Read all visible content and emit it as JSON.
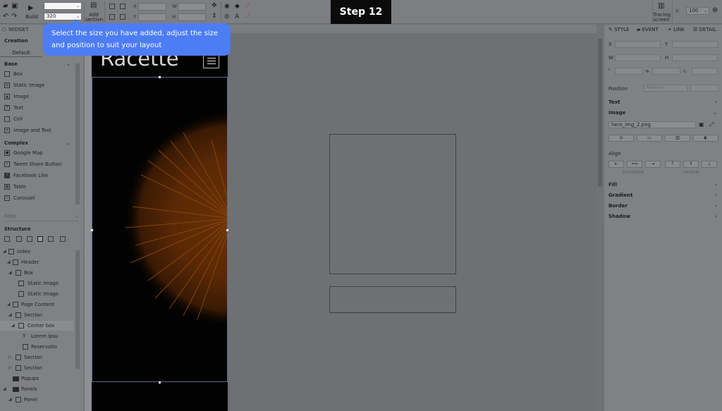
{
  "toolbar": {
    "build_label": "Build",
    "width_value": "320",
    "add_section_line1": "Add",
    "add_section_line2": "section",
    "x_label": "X",
    "w_label": "W",
    "y_label": "Y",
    "h_label": "H",
    "tracing_line1": "Tracing",
    "tracing_line2": "screen",
    "zoom_value": "100"
  },
  "step_banner": "Step 12",
  "tooltip": {
    "text": "Select the size you have added, adjust the size and position to suit your layout"
  },
  "left_panel": {
    "tab": "WIDGET",
    "creation_label": "Creation",
    "default_label": "Default",
    "base_section": "Base",
    "base_items": [
      "Box",
      "Static Image",
      "Image",
      "Text",
      "Cell",
      "Image and Text"
    ],
    "complex_section": "Complex",
    "complex_items": [
      "Google Map",
      "Tweet Share Button",
      "Facebook Like",
      "Table",
      "Carousel"
    ],
    "filter_placeholder": "Filter",
    "structure_label": "Structure",
    "tree": [
      "index",
      "Header",
      "Box",
      "Static Image",
      "Static Image",
      "Page Content",
      "Section",
      "Center box",
      "Lorem ipsu",
      "Reservatio",
      "Section",
      "Section",
      "Popups",
      "Panels",
      "Panel"
    ]
  },
  "canvas": {
    "brand_text": "Racette"
  },
  "right_panel": {
    "tabs": [
      "STYLE",
      "EVENT",
      "LINK",
      "DETAIL"
    ],
    "x_label": "X",
    "y_label": "Y",
    "w_label": "W",
    "h_label": "H",
    "position_label": "Position",
    "position_value": "Relative",
    "text_section": "Text",
    "image_section": "Image",
    "image_file": "hero_img_2.png",
    "align_label": "Align",
    "horizontal_label": "horizontal",
    "vertical_label": "vertical",
    "sections": [
      "Fill",
      "Gradient",
      "Border",
      "Shadow"
    ]
  }
}
